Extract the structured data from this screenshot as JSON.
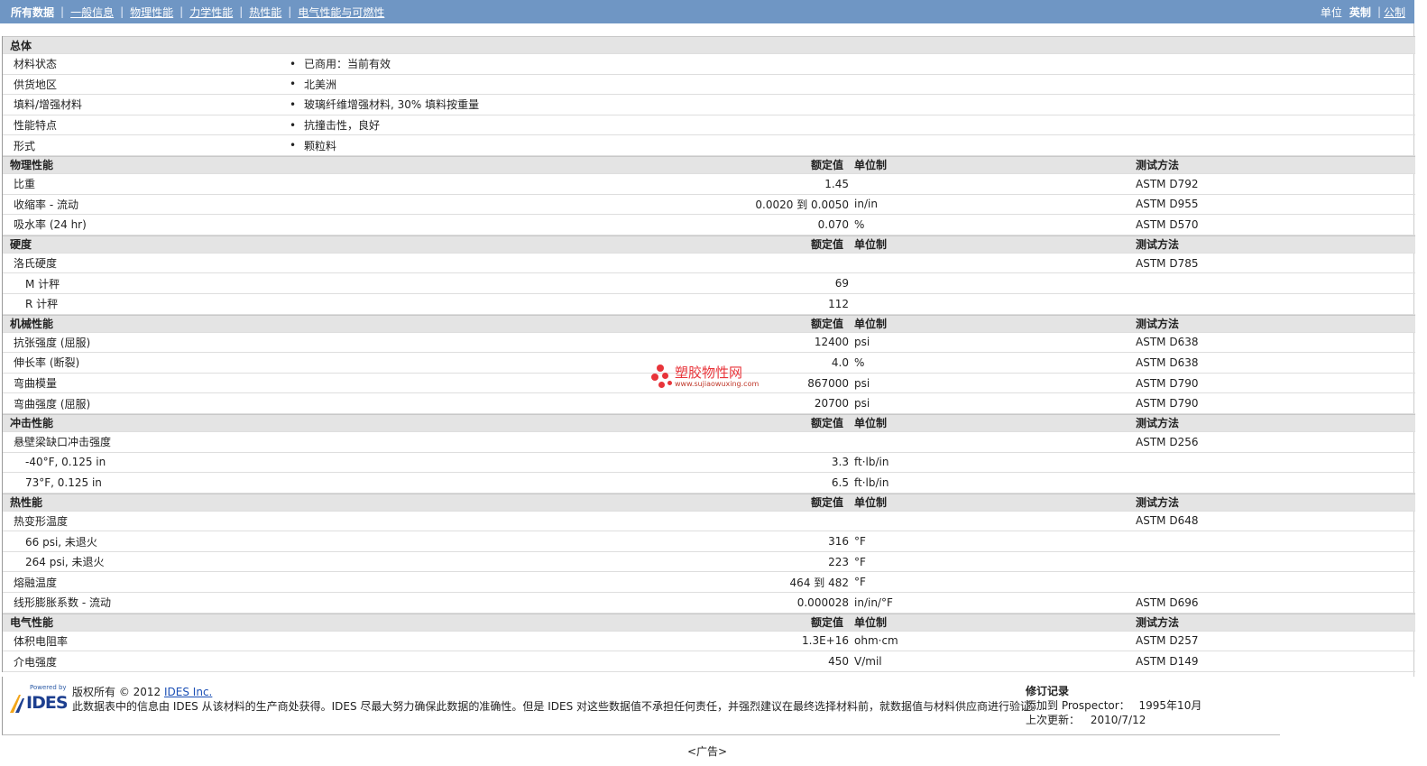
{
  "nav": {
    "tabs": [
      "所有数据",
      "一般信息",
      "物理性能",
      "力学性能",
      "热性能",
      "电气性能与可燃性"
    ],
    "units_label": "单位",
    "units": [
      "英制",
      "公制"
    ]
  },
  "general": {
    "title": "总体",
    "rows": [
      {
        "label": "材料状态",
        "value": "已商用：当前有效"
      },
      {
        "label": "供货地区",
        "value": "北美洲"
      },
      {
        "label": "填料/增强材料",
        "value": "玻璃纤维增强材料, 30% 填料按重量"
      },
      {
        "label": "性能特点",
        "value": "抗撞击性，良好"
      },
      {
        "label": "形式",
        "value": "颗粒料"
      }
    ]
  },
  "col_headers": {
    "value": "额定值",
    "unit": "单位制",
    "test": "测试方法"
  },
  "sections": [
    {
      "title": "物理性能",
      "rows": [
        {
          "label": "比重",
          "value": "1.45",
          "unit": "",
          "test": "ASTM D792",
          "sub": false
        },
        {
          "label": "收缩率 - 流动",
          "value": "0.0020 到  0.0050",
          "unit": "in/in",
          "test": "ASTM D955",
          "sub": false
        },
        {
          "label": "吸水率 (24 hr)",
          "value": "0.070",
          "unit": "%",
          "test": "ASTM D570",
          "sub": false
        }
      ]
    },
    {
      "title": "硬度",
      "rows": [
        {
          "label": "洛氏硬度",
          "value": "",
          "unit": "",
          "test": "ASTM D785",
          "sub": false
        },
        {
          "label": "M 计秤",
          "value": "69",
          "unit": "",
          "test": "",
          "sub": true
        },
        {
          "label": "R 计秤",
          "value": "112",
          "unit": "",
          "test": "",
          "sub": true
        }
      ]
    },
    {
      "title": "机械性能",
      "rows": [
        {
          "label": "抗张强度 (屈服)",
          "value": "12400",
          "unit": "psi",
          "test": "ASTM D638",
          "sub": false
        },
        {
          "label": "伸长率 (断裂)",
          "value": "4.0",
          "unit": "%",
          "test": "ASTM D638",
          "sub": false
        },
        {
          "label": "弯曲模量",
          "value": "867000",
          "unit": "psi",
          "test": "ASTM D790",
          "sub": false
        },
        {
          "label": "弯曲强度 (屈服)",
          "value": "20700",
          "unit": "psi",
          "test": "ASTM D790",
          "sub": false
        }
      ]
    },
    {
      "title": "冲击性能",
      "rows": [
        {
          "label": "悬壁梁缺口冲击强度",
          "value": "",
          "unit": "",
          "test": "ASTM D256",
          "sub": false
        },
        {
          "label": "-40°F, 0.125 in",
          "value": "3.3",
          "unit": "ft·lb/in",
          "test": "",
          "sub": true
        },
        {
          "label": "73°F, 0.125 in",
          "value": "6.5",
          "unit": "ft·lb/in",
          "test": "",
          "sub": true
        }
      ]
    },
    {
      "title": "热性能",
      "rows": [
        {
          "label": "热变形温度",
          "value": "",
          "unit": "",
          "test": "ASTM D648",
          "sub": false
        },
        {
          "label": "66 psi, 未退火",
          "value": "316",
          "unit": "°F",
          "test": "",
          "sub": true
        },
        {
          "label": "264 psi, 未退火",
          "value": "223",
          "unit": "°F",
          "test": "",
          "sub": true
        },
        {
          "label": "熔融温度",
          "value": "464 到  482",
          "unit": "°F",
          "test": "",
          "sub": false
        },
        {
          "label": "线形膨胀系数 - 流动",
          "value": "0.000028",
          "unit": "in/in/°F",
          "test": "ASTM D696",
          "sub": false
        }
      ]
    },
    {
      "title": "电气性能",
      "rows": [
        {
          "label": "体积电阻率",
          "value": "1.3E+16",
          "unit": "ohm·cm",
          "test": "ASTM D257",
          "sub": false
        },
        {
          "label": "介电强度",
          "value": "450",
          "unit": "V/mil",
          "test": "ASTM D149",
          "sub": false
        }
      ]
    }
  ],
  "watermark": {
    "text": "塑胶物性网",
    "url": "www.sujiaowuxing.com"
  },
  "footer": {
    "logo_small": "Powered by",
    "logo": "IDES",
    "copyright_prefix": "版权所有 © 2012",
    "copyright_link": "IDES Inc.",
    "disclaimer": "此数据表中的信息由 IDES 从该材料的生产商处获得。IDES 尽最大努力确保此数据的准确性。但是 IDES 对这些数据值不承担任何责任，并强烈建议在最终选择材料前，就数据值与材料供应商进行验证。",
    "revision_title": "修订记录",
    "added_label": "添加到 Prospector：",
    "added_value": "1995年10月",
    "updated_label": "上次更新：",
    "updated_value": "2010/7/12"
  },
  "ad": "<广告>"
}
